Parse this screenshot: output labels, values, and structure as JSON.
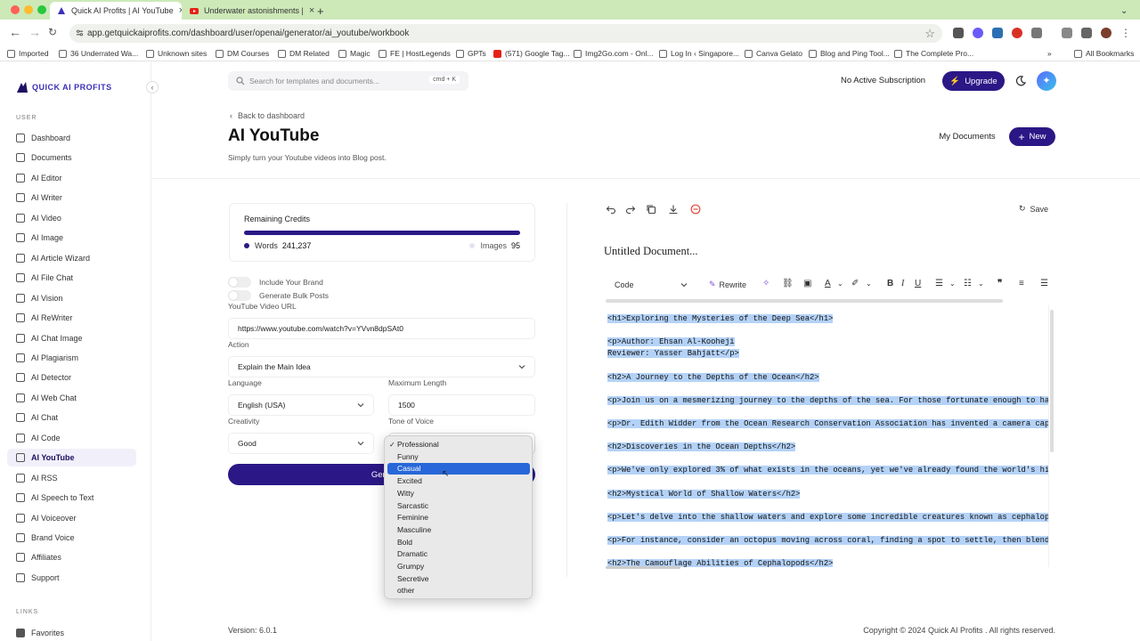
{
  "browser": {
    "tabs": [
      {
        "title": "Quick AI Profits | AI YouTube",
        "active": true
      },
      {
        "title": "Underwater astonishments | ",
        "active": false
      }
    ],
    "url": "app.getquickaiprofits.com/dashboard/user/openai/generator/ai_youtube/workbook",
    "bookmarks": [
      "Imported",
      "36 Underrated Wa...",
      "Unknown sites",
      "DM Courses",
      "DM Related",
      "Magic",
      "FE | HostLegends",
      "GPTs",
      "(571) Google Tag...",
      "Img2Go.com - Onl...",
      "Log In ‹ Singapore...",
      "Canva Gelato",
      "Blog and Ping Tool...",
      "The Complete Pro..."
    ],
    "all_bookmarks": "All Bookmarks"
  },
  "brand": {
    "name": "QUICK AI PROFITS",
    "accent": "#2b1886"
  },
  "sidebar": {
    "user_label": "USER",
    "items": [
      {
        "label": "Dashboard"
      },
      {
        "label": "Documents"
      },
      {
        "label": "AI Editor"
      },
      {
        "label": "AI Writer"
      },
      {
        "label": "AI Video"
      },
      {
        "label": "AI Image"
      },
      {
        "label": "AI Article Wizard"
      },
      {
        "label": "AI File Chat"
      },
      {
        "label": "AI Vision"
      },
      {
        "label": "AI ReWriter"
      },
      {
        "label": "AI Chat Image"
      },
      {
        "label": "AI Plagiarism"
      },
      {
        "label": "AI Detector"
      },
      {
        "label": "AI Web Chat"
      },
      {
        "label": "AI Chat"
      },
      {
        "label": "AI Code"
      },
      {
        "label": "AI YouTube"
      },
      {
        "label": "AI RSS"
      },
      {
        "label": "AI Speech to Text"
      },
      {
        "label": "AI Voiceover"
      },
      {
        "label": "Brand Voice"
      },
      {
        "label": "Affiliates"
      },
      {
        "label": "Support"
      }
    ],
    "links_label": "LINKS",
    "favorites": "Favorites"
  },
  "topbar": {
    "search_placeholder": "Search for templates and documents...",
    "shortcut": "cmd + K",
    "subscription": "No Active Subscription",
    "upgrade": "Upgrade"
  },
  "header": {
    "back": "Back to dashboard",
    "title": "AI YouTube",
    "subtitle": "Simply turn your Youtube videos into Blog post.",
    "my_documents": "My Documents",
    "new": "New"
  },
  "credits": {
    "label": "Remaining Credits",
    "words_label": "Words",
    "words": "241,237",
    "images_label": "Images",
    "images": "95",
    "words_fraction": 1.0
  },
  "form": {
    "include_brand": "Include Your Brand",
    "bulk_posts": "Generate Bulk Posts",
    "url_label": "YouTube Video URL",
    "url_value": "https://www.youtube.com/watch?v=YVvn8dpSAt0",
    "action_label": "Action",
    "action_value": "Explain the Main Idea",
    "language_label": "Language",
    "language_value": "English (USA)",
    "maxlen_label": "Maximum Length",
    "maxlen_value": "1500",
    "creativity_label": "Creativity",
    "creativity_value": "Good",
    "tone_label": "Tone of Voice",
    "generate": "Gene",
    "tone_options": [
      "Professional",
      "Funny",
      "Casual",
      "Excited",
      "Witty",
      "Sarcastic",
      "Feminine",
      "Masculine",
      "Bold",
      "Dramatic",
      "Grumpy",
      "Secretive",
      "other"
    ],
    "tone_checked": "Professional",
    "tone_highlighted": "Casual"
  },
  "editor": {
    "save": "Save",
    "doc_title": "Untitled Document...",
    "format": "Code",
    "rewrite": "Rewrite",
    "lines": [
      "<h1>Exploring the Mysteries of the Deep Sea</h1>",
      "",
      "<p>Author: Ehsan Al-Kooheji",
      "Reviewer: Yasser Bahjatt</p>",
      "",
      "<h2>A Journey to the Depths of the Ocean</h2>",
      "",
      "<p>Join us on a mesmerizing journey to the depths of the sea. For those fortunate enough to ha",
      "",
      "<p>Dr. Edith Widder from the Ocean Research Conservation Association has invented a camera cap",
      "",
      "<h2>Discoveries in the Ocean Depths</h2>",
      "",
      "<p>We've only explored 3% of what exists in the oceans, yet we've already found the world's hi",
      "",
      "<h2>Mystical World of Shallow Waters</h2>",
      "",
      "<p>Let's delve into the shallow waters and explore some incredible creatures known as cephalop",
      "",
      "<p>For instance, consider an octopus moving across coral, finding a spot to settle, then blend",
      "",
      "<h2>The Camouflage Abilities of Cephalopods</h2>"
    ]
  },
  "footer": {
    "version": "Version: 6.0.1",
    "copyright": "Copyright © 2024 Quick AI Profits . All rights reserved."
  }
}
